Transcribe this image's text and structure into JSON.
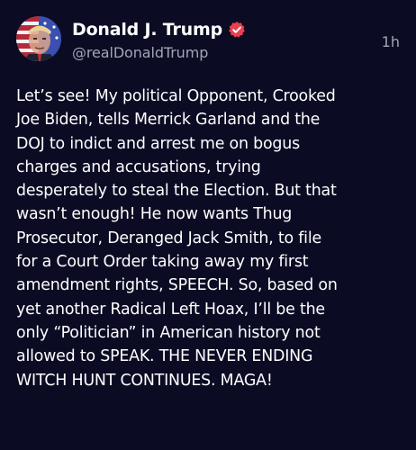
{
  "post": {
    "author": {
      "display_name": "Donald J. Trump",
      "handle": "@realDonaldTrump",
      "verified_icon": "verified-badge-icon",
      "avatar_icon": "avatar"
    },
    "timestamp": "1h",
    "text_lines": [
      "Let’s see! My political Opponent, Crooked",
      "Joe Biden, tells Merrick Garland and the",
      "DOJ to indict and arrest me on bogus",
      "charges and accusations, trying",
      "desperately to steal the Election. But that",
      "wasn’t enough! He now wants Thug",
      "Prosecutor, Deranged Jack Smith, to file",
      "for a Court Order taking away my first",
      "amendment rights, SPEECH. So, based on",
      "yet another Radical Left Hoax, I’ll be the",
      "only “Politician” in American history not",
      "allowed to SPEAK. THE NEVER ENDING",
      "WITCH HUNT CONTINUES. MAGA!"
    ]
  },
  "colors": {
    "background": "#0b0b24",
    "primary_text": "#ffffff",
    "secondary_text": "#a3a3b8",
    "verified_badge": "#e8404f"
  }
}
